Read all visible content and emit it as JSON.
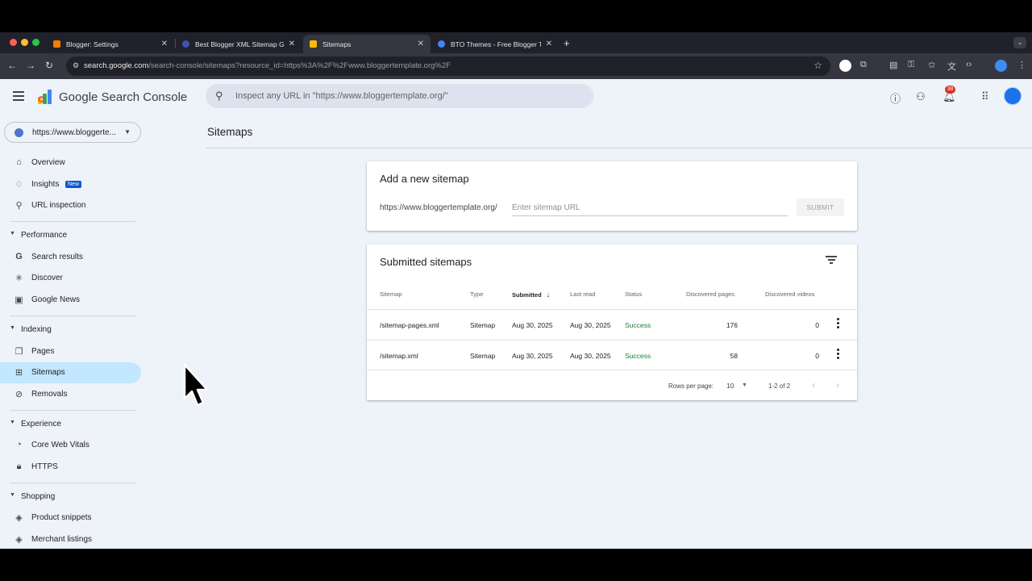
{
  "browser": {
    "tabs": [
      {
        "title": "Blogger: Settings",
        "favicon_color": "#f57c00"
      },
      {
        "title": "Best Blogger XML Sitemap Ge",
        "favicon_color": "#3f51b5"
      },
      {
        "title": "Sitemaps",
        "favicon_color": "#fbbc04"
      },
      {
        "title": "BTO Themes - Free Blogger T",
        "favicon_color": "#4285f4"
      }
    ],
    "url_main": "search.google.com",
    "url_path": "/search-console/sitemaps?resource_id=https%3A%2F%2Fwww.bloggertemplate.org%2F"
  },
  "header": {
    "product_name": "Google Search Console",
    "inspect_placeholder": "Inspect any URL in \"https://www.bloggertemplate.org/\"",
    "notification_count": "38"
  },
  "sidebar": {
    "property": "https://www.bloggerte...",
    "items_top": [
      {
        "label": "Overview"
      },
      {
        "label": "Insights",
        "badge": "New"
      },
      {
        "label": "URL inspection"
      }
    ],
    "performance": {
      "label": "Performance",
      "items": [
        {
          "label": "Search results"
        },
        {
          "label": "Discover"
        },
        {
          "label": "Google News"
        }
      ]
    },
    "indexing": {
      "label": "Indexing",
      "items": [
        {
          "label": "Pages"
        },
        {
          "label": "Sitemaps"
        },
        {
          "label": "Removals"
        }
      ]
    },
    "experience": {
      "label": "Experience",
      "items": [
        {
          "label": "Core Web Vitals"
        },
        {
          "label": "HTTPS"
        }
      ]
    },
    "shopping": {
      "label": "Shopping",
      "items": [
        {
          "label": "Product snippets"
        },
        {
          "label": "Merchant listings"
        }
      ]
    }
  },
  "main": {
    "title": "Sitemaps",
    "add_card": {
      "title": "Add a new sitemap",
      "prefix": "https://www.bloggertemplate.org/",
      "placeholder": "Enter sitemap URL",
      "submit_label": "SUBMIT"
    },
    "submitted": {
      "title": "Submitted sitemaps",
      "columns": [
        "Sitemap",
        "Type",
        "Submitted",
        "Last read",
        "Status",
        "Discovered pages",
        "Discovered videos"
      ],
      "sort_indicator": "↓",
      "rows": [
        {
          "sitemap": "/sitemap-pages.xml",
          "type": "Sitemap",
          "submitted": "Aug 30, 2025",
          "last_read": "Aug 30, 2025",
          "status": "Success",
          "pages": "176",
          "videos": "0"
        },
        {
          "sitemap": "/sitemap.xml",
          "type": "Sitemap",
          "submitted": "Aug 30, 2025",
          "last_read": "Aug 30, 2025",
          "status": "Success",
          "pages": "58",
          "videos": "0"
        }
      ],
      "rows_per_page_label": "Rows per page:",
      "rows_per_page_value": "10",
      "range": "1-2 of 2"
    }
  },
  "colors": {
    "accent": "#1a73e8",
    "success": "#188038",
    "active_nav": "#c2e7ff"
  }
}
